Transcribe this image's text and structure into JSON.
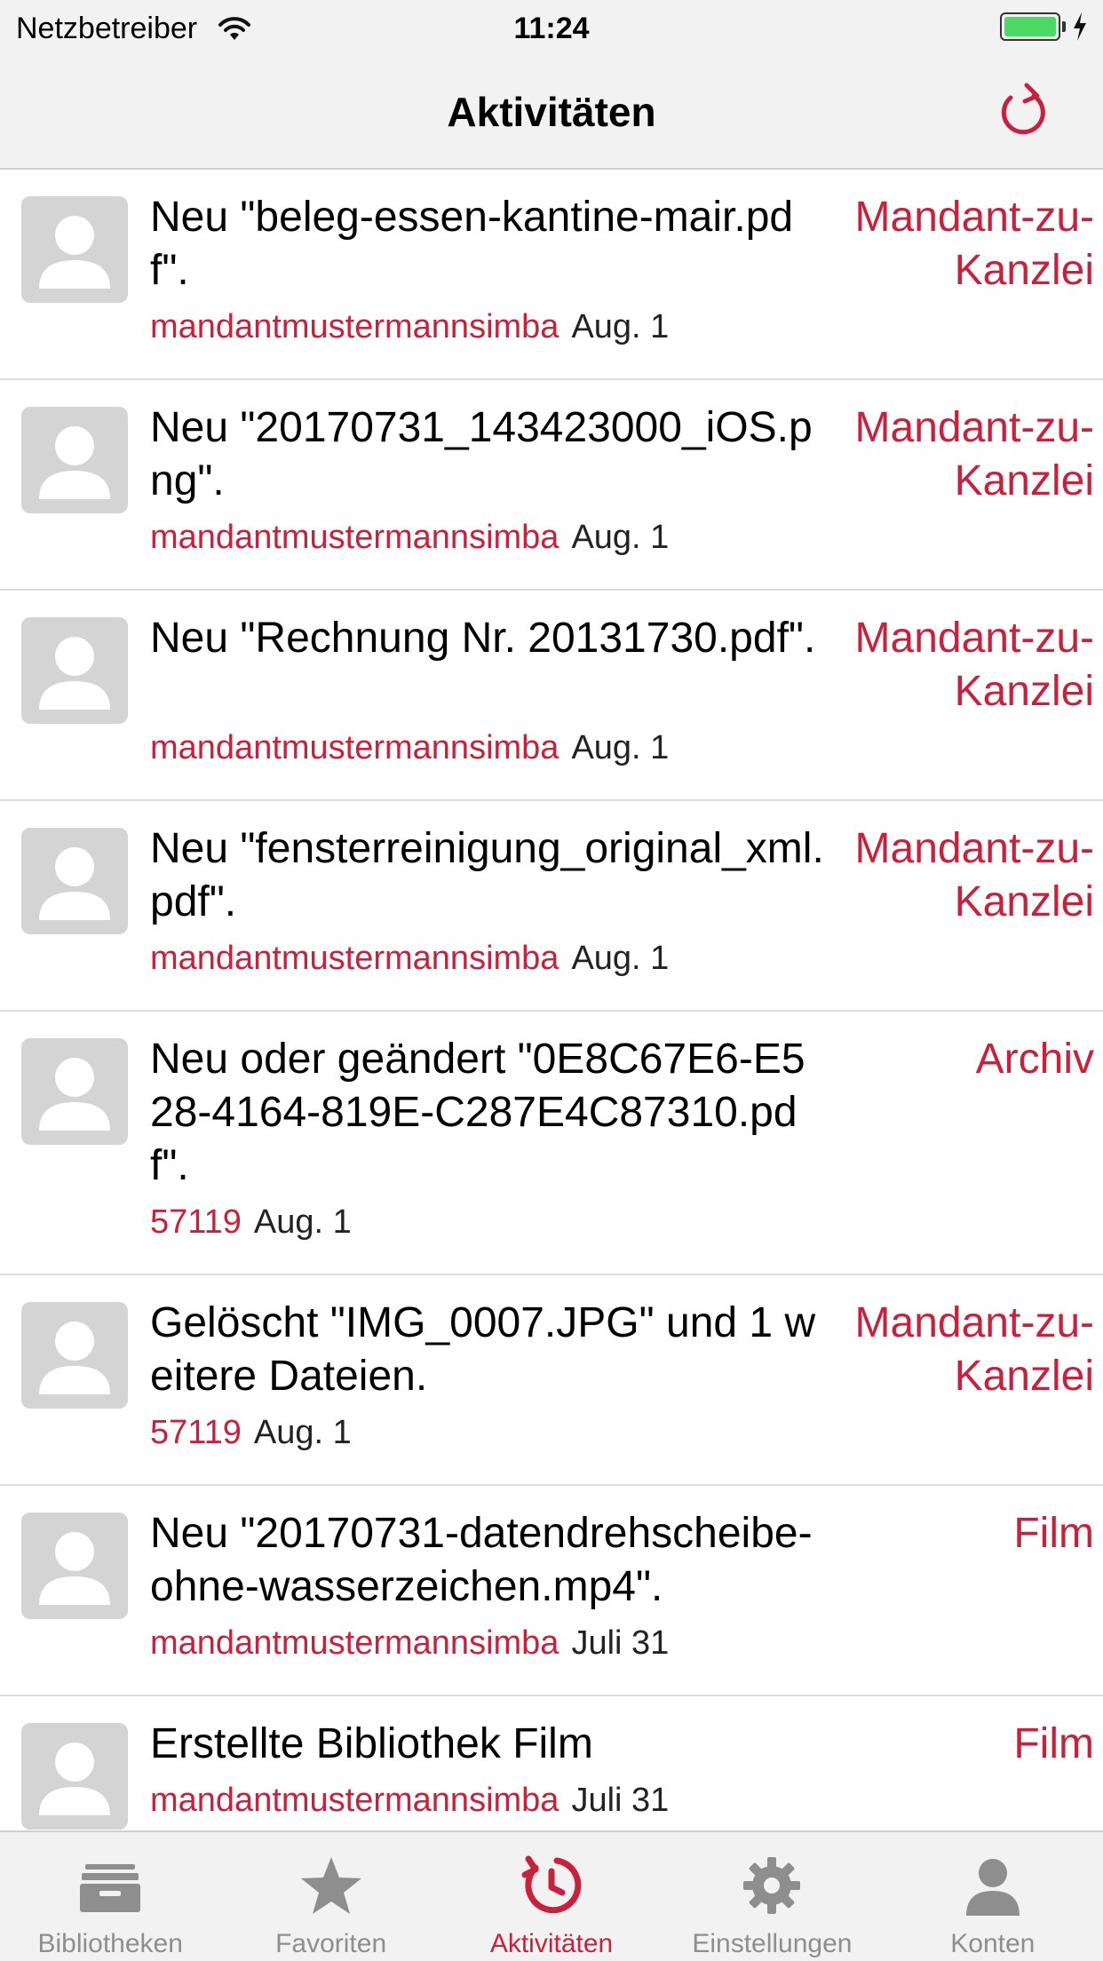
{
  "status_bar": {
    "carrier": "Netzbetreiber",
    "time": "11:24",
    "battery_level": 1.0
  },
  "nav": {
    "title": "Aktivitäten",
    "refresh_icon": "refresh-icon"
  },
  "colors": {
    "accent": "#c8213c",
    "bar_bg": "#f2f2f2",
    "avatar_bg": "#d4d4d4",
    "battery": "#4cd964",
    "tab_inactive": "#8e8e8e"
  },
  "activities": [
    {
      "title": "Neu \"beleg-essen-kantine-mair.pdf\".",
      "user": "mandantmustermannsimba",
      "date": "Aug. 1",
      "library": "Mandant-zu-Kanzlei"
    },
    {
      "title": "Neu \"20170731_143423000_iOS.png\".",
      "user": "mandantmustermannsimba",
      "date": "Aug. 1",
      "library": "Mandant-zu-Kanzlei"
    },
    {
      "title": "Neu \"Rechnung Nr. 20131730.pdf\".",
      "user": "mandantmustermannsimba",
      "date": "Aug. 1",
      "library": "Mandant-zu-Kanzlei"
    },
    {
      "title": "Neu \"fensterreinigung_original_xml.pdf\".",
      "user": "mandantmustermannsimba",
      "date": "Aug. 1",
      "library": "Mandant-zu-Kanzlei"
    },
    {
      "title": "Neu oder geändert \"0E8C67E6-E528-4164-819E-C287E4C87310.pdf\".",
      "user": "57119",
      "date": "Aug. 1",
      "library": "Archiv"
    },
    {
      "title": "Gelöscht \"IMG_0007.JPG\" und 1 weitere Dateien.",
      "user": "57119",
      "date": "Aug. 1",
      "library": "Mandant-zu-Kanzlei"
    },
    {
      "title": "Neu \"20170731-datendrehscheibe-ohne-wasserzeichen.mp4\".",
      "user": "mandantmustermannsimba",
      "date": "Juli 31",
      "library": "Film"
    },
    {
      "title": "Erstellte Bibliothek Film",
      "user": "mandantmustermannsimba",
      "date": "Juli 31",
      "library": "Film"
    }
  ],
  "tabs": [
    {
      "label": "Bibliotheken",
      "icon": "library-icon",
      "active": false
    },
    {
      "label": "Favoriten",
      "icon": "star-icon",
      "active": false
    },
    {
      "label": "Aktivitäten",
      "icon": "activity-icon",
      "active": true
    },
    {
      "label": "Einstellungen",
      "icon": "gear-icon",
      "active": false
    },
    {
      "label": "Konten",
      "icon": "account-icon",
      "active": false
    }
  ]
}
